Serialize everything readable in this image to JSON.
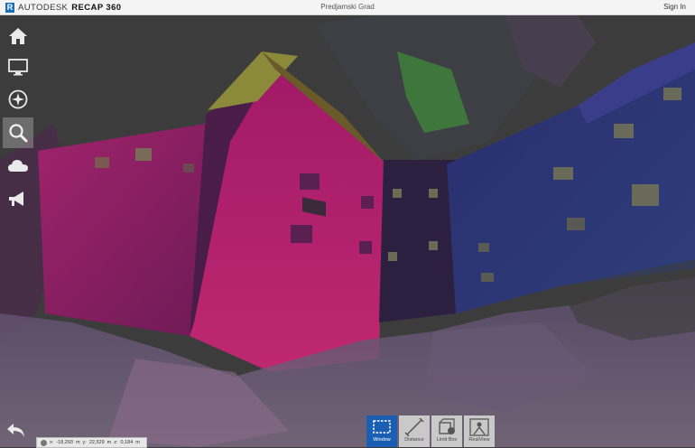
{
  "header": {
    "brand": "AUTODESK",
    "product": "RECAP 360",
    "title": "Predjamski Grad",
    "signin": "Sign In"
  },
  "sidebar": {
    "items": [
      {
        "icon": "home-icon"
      },
      {
        "icon": "display-icon"
      },
      {
        "icon": "compass-icon"
      },
      {
        "icon": "search-icon",
        "active": true
      },
      {
        "icon": "cloud-icon"
      },
      {
        "icon": "megaphone-icon"
      }
    ]
  },
  "tools": [
    {
      "label": "Window",
      "icon": "window-select-icon",
      "active": true
    },
    {
      "label": "Distance",
      "icon": "distance-icon"
    },
    {
      "label": "Limit Box",
      "icon": "limit-box-icon"
    },
    {
      "label": "RealView",
      "icon": "realview-icon"
    }
  ],
  "coords": {
    "x_label": "x:",
    "x": "-18,293",
    "x_unit": "m",
    "y_label": "y:",
    "y": "22,529",
    "y_unit": "m",
    "z_label": "z:",
    "z": "0,184",
    "z_unit": "m"
  },
  "colors": {
    "accent": "#1a5fb4",
    "brand": "#1b6fb5"
  }
}
